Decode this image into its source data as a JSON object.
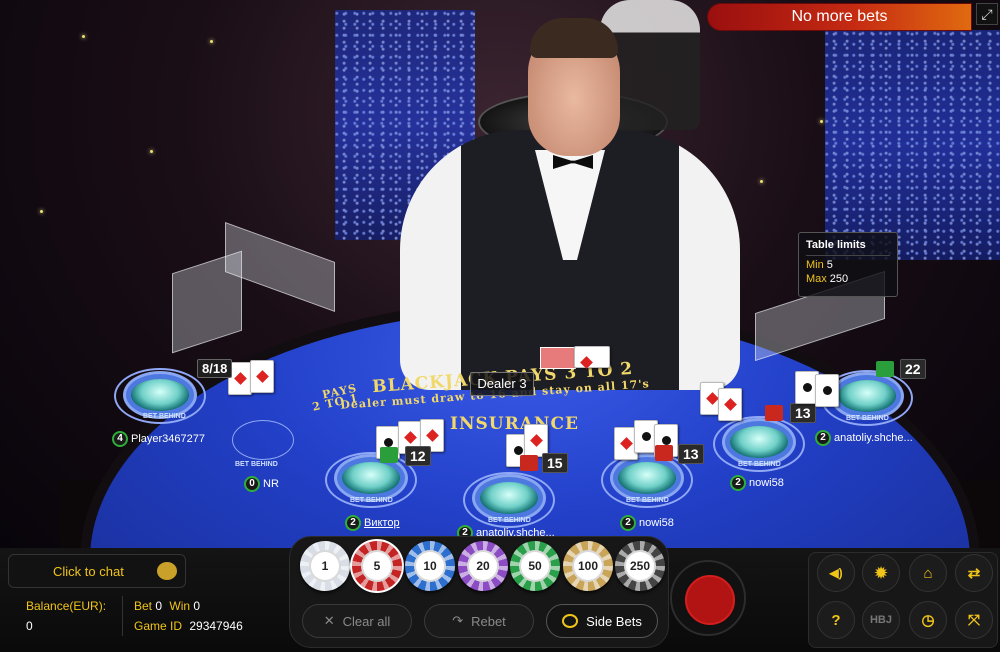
{
  "status": {
    "text": "No more bets"
  },
  "table_limits": {
    "title": "Table limits",
    "min_label": "Min",
    "min_value": "5",
    "max_label": "Max",
    "max_value": "250"
  },
  "dealer": {
    "label": "Dealer 3"
  },
  "shoe": {
    "count": "8/18"
  },
  "felt": {
    "line1": "BLACKJACK PAYS 3 TO 2",
    "line2": "Dealer must draw to 16 and stay on all 17's",
    "line3": "INSURANCE",
    "line4": "PAYS",
    "line5": "2 TO 1"
  },
  "seats": [
    {
      "name": "Player3467277",
      "badge": "4",
      "score": ""
    },
    {
      "name": "NR",
      "badge": "0",
      "score": ""
    },
    {
      "name": "Виктор",
      "badge": "2",
      "score": "12"
    },
    {
      "name": "anatoliy.shche...",
      "badge": "2",
      "score": "15"
    },
    {
      "name": "nowi58",
      "badge": "2",
      "score": "13"
    },
    {
      "name": "nowi58",
      "badge": "2",
      "score": "13"
    },
    {
      "name": "anatoliy.shche...",
      "badge": "2",
      "score": "22"
    }
  ],
  "bet_behind": "BET BEHIND",
  "chat": {
    "label": "Click to chat"
  },
  "account": {
    "balance_label": "Balance(EUR):",
    "balance": "0",
    "bet_label": "Bet",
    "bet": "0",
    "win_label": "Win",
    "win": "0",
    "game_id_label": "Game ID",
    "game_id": "29347946"
  },
  "chips": [
    {
      "value": "1",
      "color": "#d8dde6"
    },
    {
      "value": "5",
      "color": "#c42424"
    },
    {
      "value": "10",
      "color": "#2d6fcf"
    },
    {
      "value": "20",
      "color": "#8b4cc4"
    },
    {
      "value": "50",
      "color": "#2aa04a"
    },
    {
      "value": "100",
      "color": "#c9a55a"
    },
    {
      "value": "250",
      "color": "#444444"
    }
  ],
  "selected_chip": "5",
  "actions": {
    "clear_all": "Clear all",
    "rebet": "Rebet",
    "side_bets": "Side Bets"
  },
  "controls": {
    "hbj": "HBJ",
    "help": "?"
  },
  "colors": {
    "accent": "#f0c419",
    "felt": "#2240c8",
    "status": "#c52a12"
  }
}
